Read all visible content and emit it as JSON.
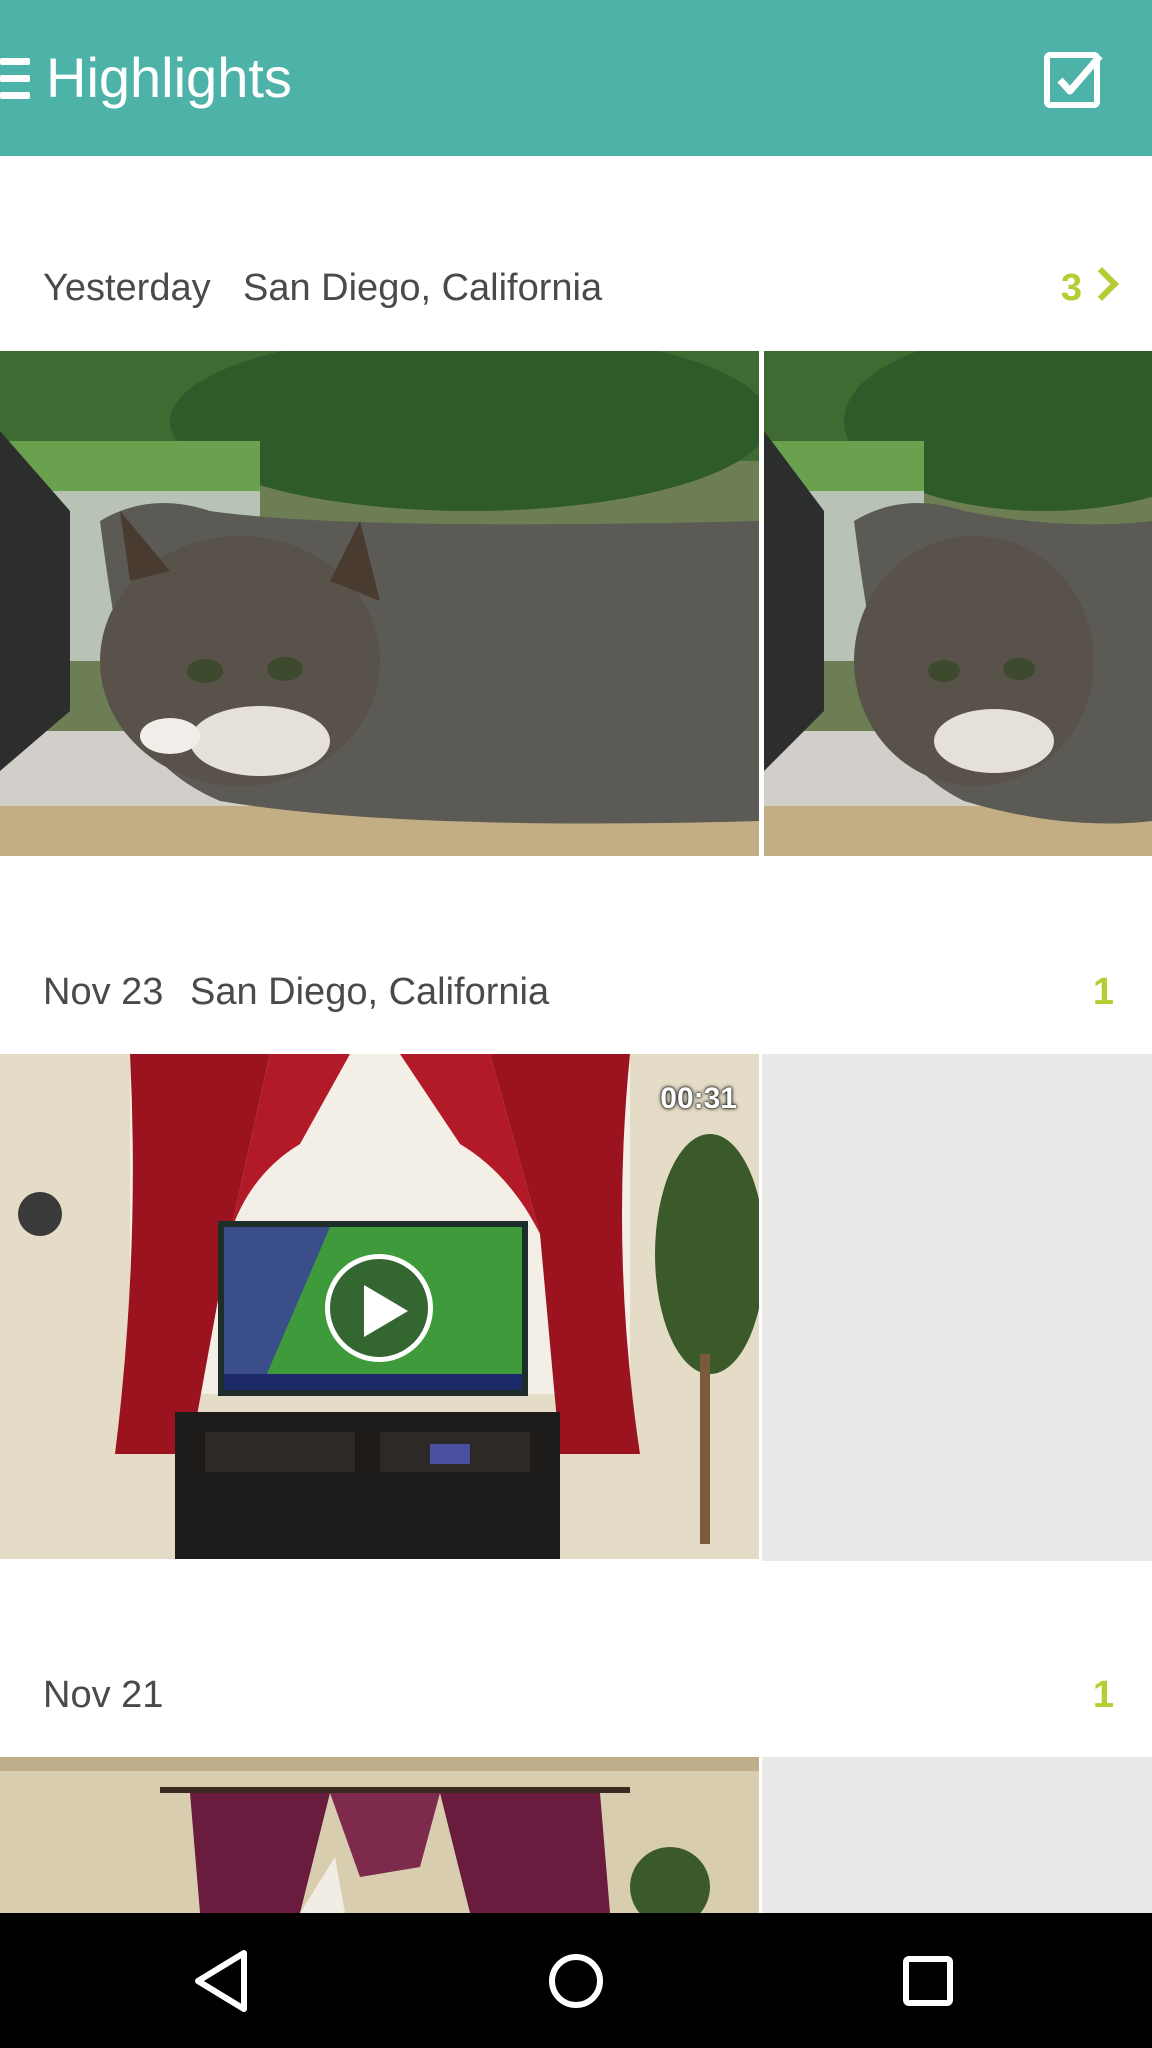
{
  "app_bar": {
    "title": "Highlights",
    "menu_icon": "hamburger-icon",
    "select_icon": "checkbox-icon",
    "color": "#4db3a9"
  },
  "sections": [
    {
      "date": "Yesterday",
      "location": "San Diego, California",
      "count": "3",
      "has_chevron": true
    },
    {
      "date": "Nov 23",
      "location": "San Diego, California",
      "count": "1",
      "video_duration": "00:31"
    },
    {
      "date": "Nov 21",
      "location": "",
      "count": "1"
    }
  ],
  "accent_color": "#b7cc32",
  "nav_bar": {
    "back_icon": "back-triangle-icon",
    "home_icon": "home-circle-icon",
    "recents_icon": "recents-square-icon"
  }
}
